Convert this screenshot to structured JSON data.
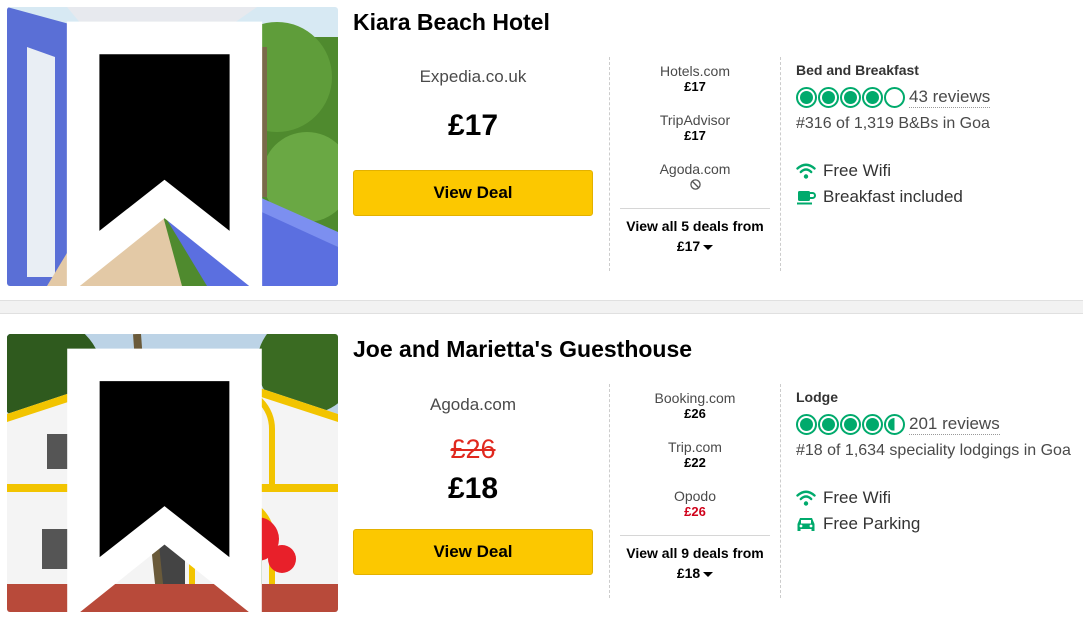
{
  "hotels": [
    {
      "name": "Kiara Beach Hotel",
      "main_provider": "Expedia.co.uk",
      "strike_price": null,
      "main_price": "£17",
      "view_deal_label": "View Deal",
      "other_offers": [
        {
          "provider": "Hotels.com",
          "price": "£17",
          "price_color": "normal"
        },
        {
          "provider": "TripAdvisor",
          "price": "£17",
          "price_color": "normal"
        },
        {
          "provider": "Agoda.com",
          "price": null,
          "unavailable_icon": "no-entry-icon"
        }
      ],
      "view_all_line1": "View all 5 deals from",
      "view_all_line2": "£17",
      "type": "Bed and Breakfast",
      "rating": 4.0,
      "reviews": "43 reviews",
      "rank": "#316 of 1,319 B&Bs in Goa",
      "amenities": [
        {
          "icon": "wifi-icon",
          "label": "Free Wifi"
        },
        {
          "icon": "coffee-cup-icon",
          "label": "Breakfast included"
        }
      ]
    },
    {
      "name": "Joe and Marietta's Guesthouse",
      "main_provider": "Agoda.com",
      "strike_price": "£26",
      "main_price": "£18",
      "view_deal_label": "View Deal",
      "other_offers": [
        {
          "provider": "Booking.com",
          "price": "£26",
          "price_color": "normal"
        },
        {
          "provider": "Trip.com",
          "price": "£22",
          "price_color": "normal"
        },
        {
          "provider": "Opodo",
          "price": "£26",
          "price_color": "red"
        }
      ],
      "view_all_line1": "View all 9 deals from",
      "view_all_line2": "£18",
      "type": "Lodge",
      "rating": 4.5,
      "reviews": "201 reviews",
      "rank": "#18 of 1,634 speciality lodgings in Goa",
      "amenities": [
        {
          "icon": "wifi-icon",
          "label": "Free Wifi"
        },
        {
          "icon": "car-icon",
          "label": "Free Parking"
        }
      ]
    }
  ],
  "colors": {
    "accent_green": "#00aa6c",
    "deal_button": "#fcc800",
    "strike_red": "#e0281e",
    "opodo_red": "#d0021b"
  }
}
